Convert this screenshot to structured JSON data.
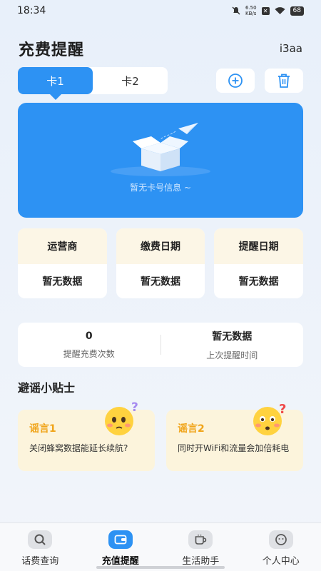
{
  "status_bar": {
    "time": "18:34",
    "net_speed": "6.50",
    "net_unit": "KB/s",
    "battery": "68"
  },
  "header": {
    "title": "充费提醒",
    "user": "i3aa"
  },
  "tabs": [
    {
      "label": "卡1",
      "active": true
    },
    {
      "label": "卡2",
      "active": false
    }
  ],
  "card_panel": {
    "empty_text": "暂无卡号信息 ~"
  },
  "info": [
    {
      "label": "运营商",
      "value": "暂无数据"
    },
    {
      "label": "缴费日期",
      "value": "暂无数据"
    },
    {
      "label": "提醒日期",
      "value": "暂无数据"
    }
  ],
  "stats": [
    {
      "value": "0",
      "label": "提醒充费次数"
    },
    {
      "value": "暂无数据",
      "label": "上次提醒时间"
    }
  ],
  "tips_section": {
    "title": "避谣小贴士",
    "items": [
      {
        "title": "谣言1",
        "text": "关闭蜂窝数据能延长续航?"
      },
      {
        "title": "谣言2",
        "text": "同时开WiFi和流量会加倍耗电"
      }
    ]
  },
  "bottom_nav": [
    {
      "label": "话费查询",
      "icon": "search-icon",
      "active": false
    },
    {
      "label": "充值提醒",
      "icon": "wallet-icon",
      "active": true
    },
    {
      "label": "生活助手",
      "icon": "cup-icon",
      "active": false
    },
    {
      "label": "个人中心",
      "icon": "face-icon",
      "active": false
    }
  ],
  "colors": {
    "accent": "#2d92f3",
    "tip_title": "#f0a419",
    "tip_bg": "#fcf4dc"
  }
}
